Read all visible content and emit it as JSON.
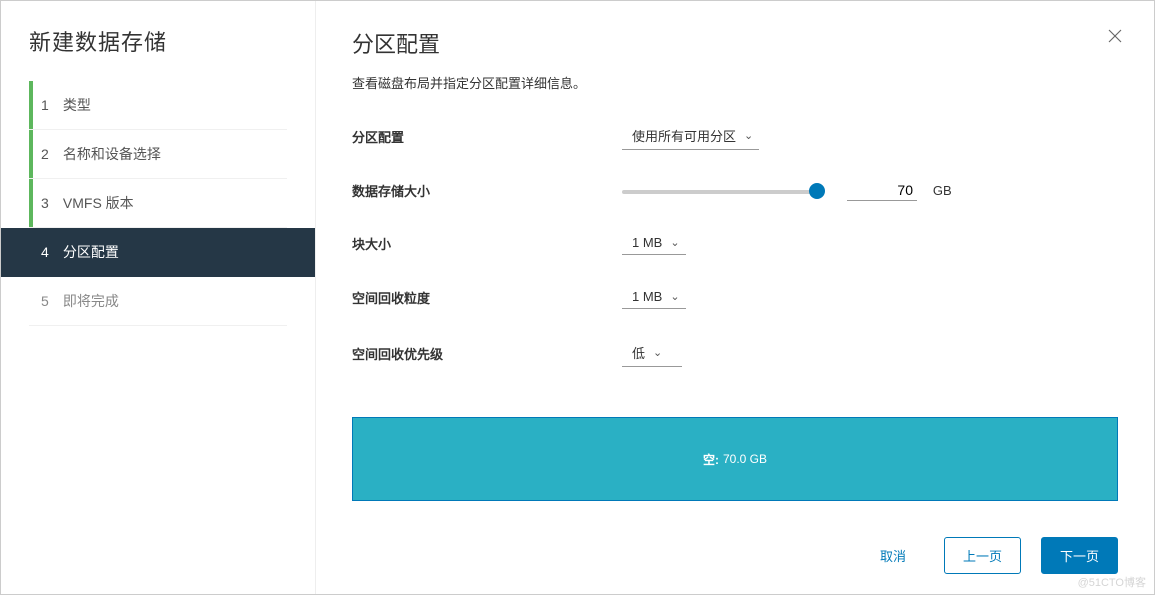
{
  "sidebar": {
    "title": "新建数据存储",
    "steps": [
      {
        "num": "1",
        "label": "类型"
      },
      {
        "num": "2",
        "label": "名称和设备选择"
      },
      {
        "num": "3",
        "label": "VMFS 版本"
      },
      {
        "num": "4",
        "label": "分区配置"
      },
      {
        "num": "5",
        "label": "即将完成"
      }
    ]
  },
  "page": {
    "title": "分区配置",
    "description": "查看磁盘布局并指定分区配置详细信息。"
  },
  "form": {
    "partition_config": {
      "label": "分区配置",
      "value": "使用所有可用分区"
    },
    "datastore_size": {
      "label": "数据存储大小",
      "value": "70",
      "unit": "GB"
    },
    "block_size": {
      "label": "块大小",
      "value": "1 MB"
    },
    "reclaim_granularity": {
      "label": "空间回收粒度",
      "value": "1 MB"
    },
    "reclaim_priority": {
      "label": "空间回收优先级",
      "value": "低"
    }
  },
  "disk": {
    "free_label": "空:",
    "free_value": "70.0 GB"
  },
  "footer": {
    "cancel": "取消",
    "back": "上一页",
    "next": "下一页"
  },
  "watermark": "@51CTO博客"
}
